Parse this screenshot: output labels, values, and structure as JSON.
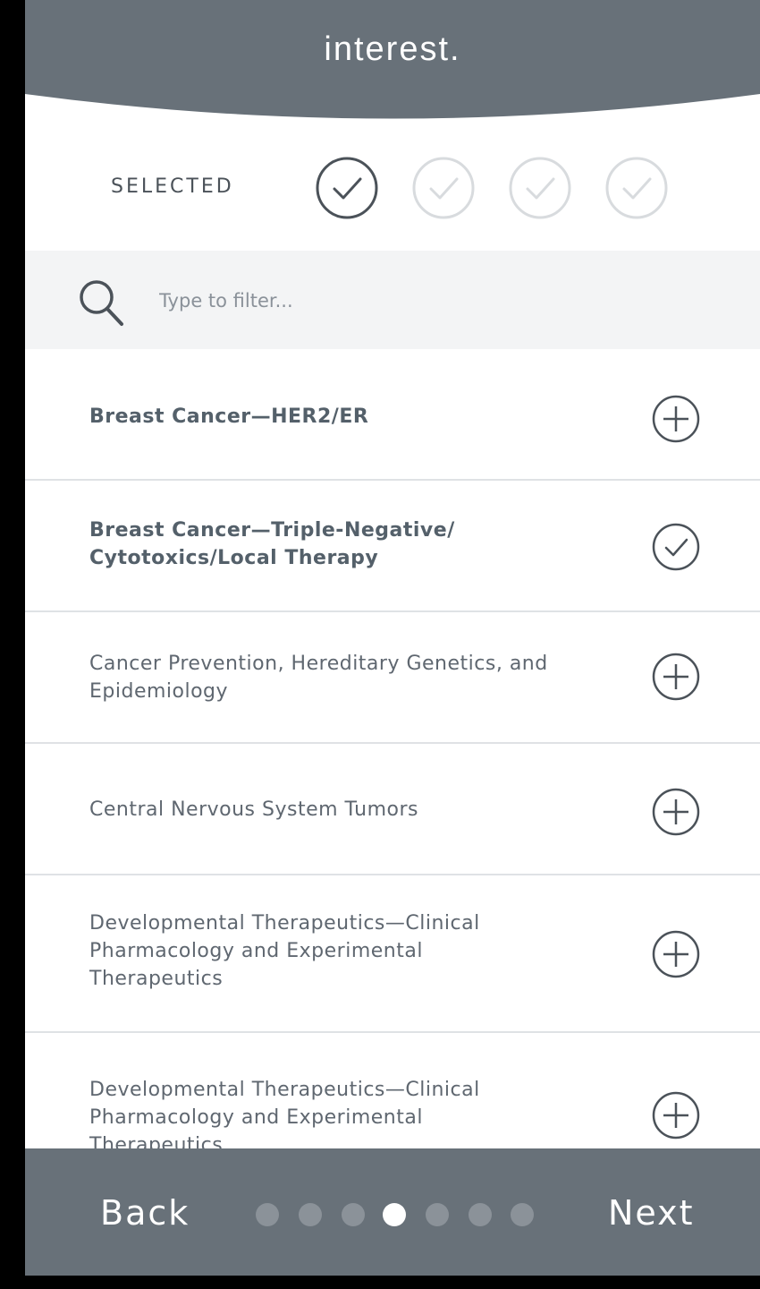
{
  "header": {
    "title_line": "interest."
  },
  "selected": {
    "label": "SELECTED",
    "slots": [
      {
        "state": "filled"
      },
      {
        "state": "empty"
      },
      {
        "state": "empty"
      },
      {
        "state": "empty"
      }
    ]
  },
  "search": {
    "placeholder": "Type to filter..."
  },
  "topics": [
    {
      "label": "Breast Cancer—HER2/ER",
      "selected": false
    },
    {
      "label": "Breast Cancer—Triple-Negative/ Cytotoxics/Local Therapy",
      "selected": true
    },
    {
      "label": "Cancer Prevention, Hereditary Genetics, and Epidemiology",
      "selected": false
    },
    {
      "label": "Central Nervous System Tumors",
      "selected": false
    },
    {
      "label": "Developmental Therapeutics—Clinical Pharmacology and Experimental Therapeutics",
      "selected": false
    },
    {
      "label": "Developmental Therapeutics—Clinical Pharmacology and Experimental Therapeutics",
      "selected": false
    }
  ],
  "footer": {
    "back_label": "Back",
    "next_label": "Next",
    "pagination": {
      "total": 7,
      "current": 4
    }
  },
  "colors": {
    "header_bg": "#687179",
    "footer_bg": "#687179",
    "icon_dark": "#4b5259",
    "icon_light": "#d8dbde"
  },
  "icons": {
    "selected_slot": "check-circle-icon",
    "add": "plus-circle-icon",
    "search": "search-icon"
  }
}
